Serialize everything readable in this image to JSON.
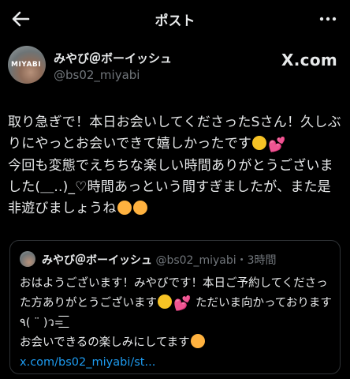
{
  "header": {
    "title": "ポスト"
  },
  "post": {
    "avatar_text": "MIYABI",
    "display_name": "みやび＠ボーイッシュ",
    "handle": "@bs02_miyabi",
    "brand": "X.com",
    "text_1": "取り急ぎで！本日お会いしてくださったSさん！久しぶりにやっとお会いできて嬉しかったです",
    "text_2": "今回も変態でえちちな楽しい時間ありがとうございました(＿..)_♡時間あっという間すぎましたが、また是非遊びましょうね"
  },
  "quote": {
    "display_name": "みやび＠ボーイッシュ",
    "handle_time": "@bs02_miyabi・3時間",
    "text_1": "おはようございます！みやびです！本日ご予約してくださった方ありがとうございます",
    "text_2": "ただいま向かっております٩( ¨ )ว=͟͟͞͞",
    "text_3": "お会いできるの楽しみにしてます",
    "link": "x.com/bs02_miyabi/st..."
  },
  "icons": {
    "back": "arrow-left-icon",
    "more": "more-horizontal-icon"
  },
  "colors": {
    "accent": "#1d9bf0",
    "muted": "#71767b",
    "text": "#e7e9ea",
    "border": "#2f3336"
  }
}
